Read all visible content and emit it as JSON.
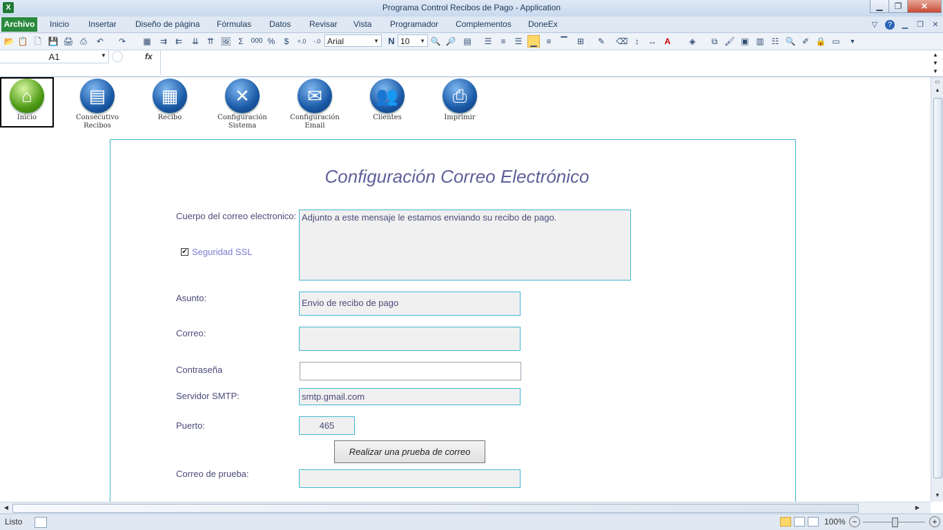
{
  "window": {
    "title": "Programa Control Recibos de Pago  -  Application",
    "app_icon": "X"
  },
  "ribbon_tabs": [
    "Archivo",
    "Inicio",
    "Insertar",
    "Diseño de página",
    "Fórmulas",
    "Datos",
    "Revisar",
    "Vista",
    "Programador",
    "Complementos",
    "DoneEx"
  ],
  "toolbar": {
    "font_name": "Arial",
    "font_size": "10",
    "bold_label": "N",
    "percent": "%",
    "currency": "$",
    "thousands": "000",
    "sum": "Σ"
  },
  "formula_bar": {
    "cell_ref": "A1",
    "fx": "fx",
    "formula": ""
  },
  "nav": {
    "inicio": "Inicio",
    "consecutivo_1": "Consecutivo",
    "consecutivo_2": "Recibos",
    "recibo": "Recibo",
    "config_sistema_1": "Configuración",
    "config_sistema_2": "Sistema",
    "config_email_1": "Configuración",
    "config_email_2": "Email",
    "clientes": "Clientes",
    "imprimir": "Imprimir"
  },
  "form": {
    "title": "Configuración Correo Electrónico",
    "body_label": "Cuerpo del correo electronico:",
    "body_value": "Adjunto a este mensaje le estamos enviando su recibo de pago.",
    "ssl_label": "Seguridad SSL",
    "ssl_checked": true,
    "subject_label": "Asunto:",
    "subject_value": "Envio de recibo de pago",
    "email_label": "Correo:",
    "email_value": "",
    "password_label": "Contraseña",
    "password_value": "",
    "smtp_label": "Servidor SMTP:",
    "smtp_value": "smtp.gmail.com",
    "port_label": "Puerto:",
    "port_value": "465",
    "test_button": "Realizar una prueba de correo",
    "test_email_label": "Correo de prueba:",
    "test_email_value": ""
  },
  "status": {
    "text": "Listo",
    "zoom": "100%"
  },
  "colors": {
    "accent_green": "#2a8a3e",
    "panel_border": "#3fb7cf",
    "label": "#4a4a7a",
    "title": "#5f5f9a"
  }
}
